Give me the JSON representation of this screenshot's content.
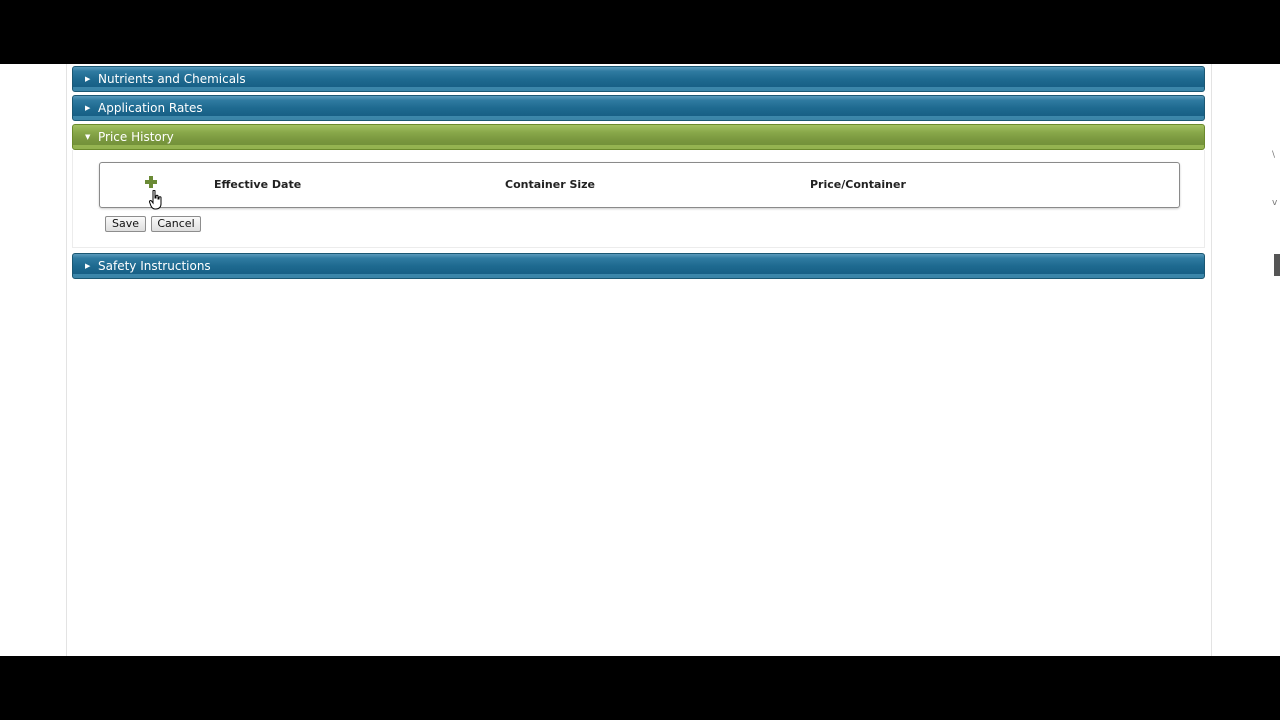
{
  "panels": {
    "nutrients": {
      "title": "Nutrients and Chemicals"
    },
    "application": {
      "title": "Application Rates"
    },
    "price_history": {
      "title": "Price History"
    },
    "safety": {
      "title": "Safety Instructions"
    }
  },
  "price_grid": {
    "columns": [
      "Effective Date",
      "Container Size",
      "Price/Container"
    ]
  },
  "buttons": {
    "save": "Save",
    "cancel": "Cancel"
  },
  "icons": {
    "collapsed_caret": "triangle-right-icon",
    "expanded_caret": "triangle-down-icon",
    "add": "plus-icon",
    "cursor": "hand-pointer-icon"
  },
  "colors": {
    "blue_header": "#1e6a90",
    "green_header": "#7a983f",
    "add_icon": "#6a8a35"
  }
}
